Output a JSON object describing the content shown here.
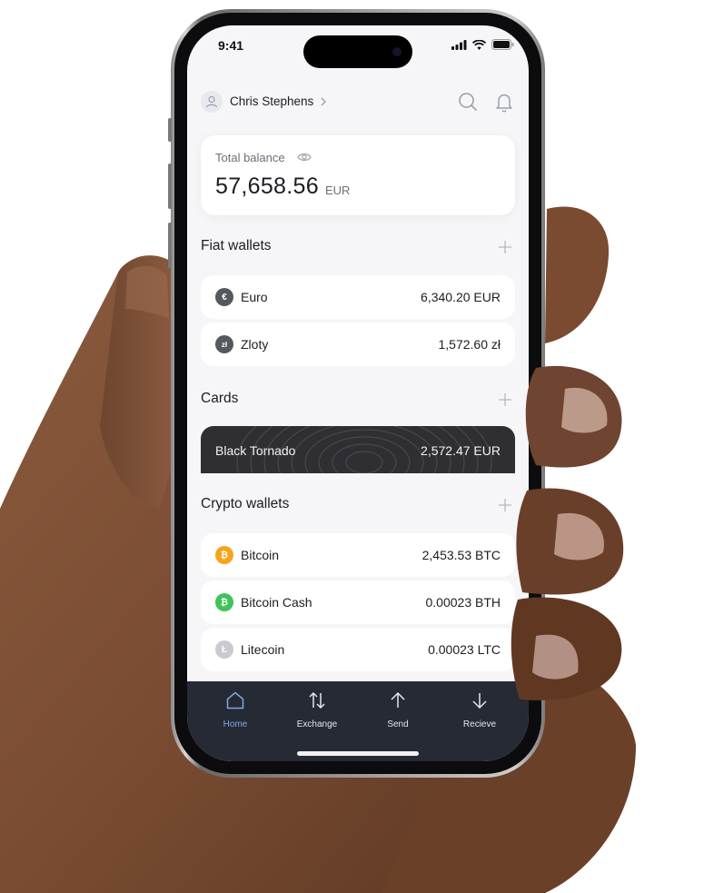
{
  "status_bar": {
    "time": "9:41"
  },
  "header": {
    "user_name": "Chris Stephens"
  },
  "balance": {
    "label": "Total balance",
    "amount": "57,658.56",
    "currency": "EUR"
  },
  "sections": {
    "fiat_title": "Fiat wallets",
    "cards_title": "Cards",
    "crypto_title": "Crypto wallets"
  },
  "fiat_wallets": [
    {
      "name": "Euro",
      "value": "6,340.20 EUR",
      "symbol": "€",
      "color": "#56585f",
      "icon": "euro-icon"
    },
    {
      "name": "Zloty",
      "value": "1,572.60 zł",
      "symbol": "zł",
      "color": "#56585f",
      "icon": "zloty-icon"
    }
  ],
  "cards": [
    {
      "name": "Black Tornado",
      "value": "2,572.47 EUR"
    }
  ],
  "crypto_wallets": [
    {
      "name": "Bitcoin",
      "value": "2,453.53 BTC",
      "symbol": "₿",
      "color": "#f4a51c",
      "icon": "bitcoin-icon"
    },
    {
      "name": "Bitcoin Cash",
      "value": "0.00023 BTH",
      "symbol": "₿",
      "color": "#3fc45a",
      "icon": "bitcoin-cash-icon"
    },
    {
      "name": "Litecoin",
      "value": "0.00023 LTC",
      "symbol": "Ł",
      "color": "#c9cbd0",
      "icon": "litecoin-icon"
    }
  ],
  "tabs": [
    {
      "label": "Home",
      "icon": "home-icon",
      "active": true
    },
    {
      "label": "Exchange",
      "icon": "exchange-arrows-icon",
      "active": false
    },
    {
      "label": "Send",
      "icon": "arrow-up-icon",
      "active": false
    },
    {
      "label": "Recieve",
      "icon": "arrow-down-icon",
      "active": false
    }
  ],
  "colors": {
    "accent": "#7fa6e6",
    "tabbar_bg": "#262a35",
    "screen_bg": "#f6f6f8"
  }
}
